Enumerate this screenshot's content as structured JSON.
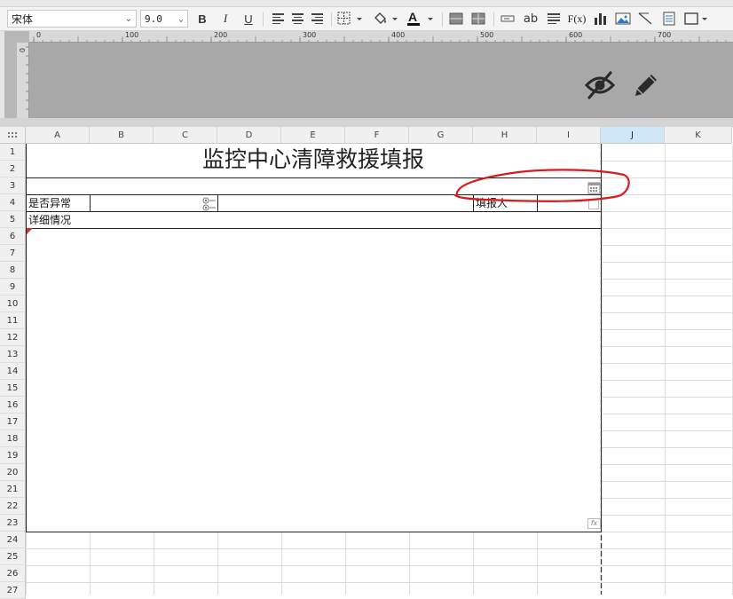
{
  "toolbar": {
    "font_name": "宋体",
    "font_size": "9.0",
    "bold_label": "B",
    "italic_label": "I",
    "underline_label": "U",
    "wrap_label": "ab",
    "formula_label": "F(x)",
    "font_color": "#111111"
  },
  "ruler": {
    "h_labels": [
      "0",
      "100",
      "200",
      "300",
      "400",
      "500",
      "600",
      "700"
    ],
    "v_label": "0"
  },
  "design_icons": [
    "eye-slash-icon",
    "pencil-icon"
  ],
  "grid": {
    "columns": [
      "A",
      "B",
      "C",
      "D",
      "E",
      "F",
      "G",
      "H",
      "I",
      "J",
      "K"
    ],
    "selected_column": "J",
    "rows": [
      "1",
      "2",
      "3",
      "4",
      "5",
      "6",
      "7",
      "8",
      "9",
      "10",
      "11",
      "12",
      "13",
      "14",
      "15",
      "16",
      "17",
      "18",
      "19",
      "20",
      "21",
      "22",
      "23",
      "24",
      "25",
      "26",
      "27"
    ]
  },
  "report": {
    "title": "监控中心清障救援填报",
    "abnormal_label": "是否异常",
    "reporter_label": "填报人",
    "detail_label": "详细情况",
    "formula_marker": "fx"
  },
  "colors": {
    "annotation": "#d91a1a",
    "selected_header": "#cfe8f7",
    "canvas_bg": "#a8a8a8"
  }
}
